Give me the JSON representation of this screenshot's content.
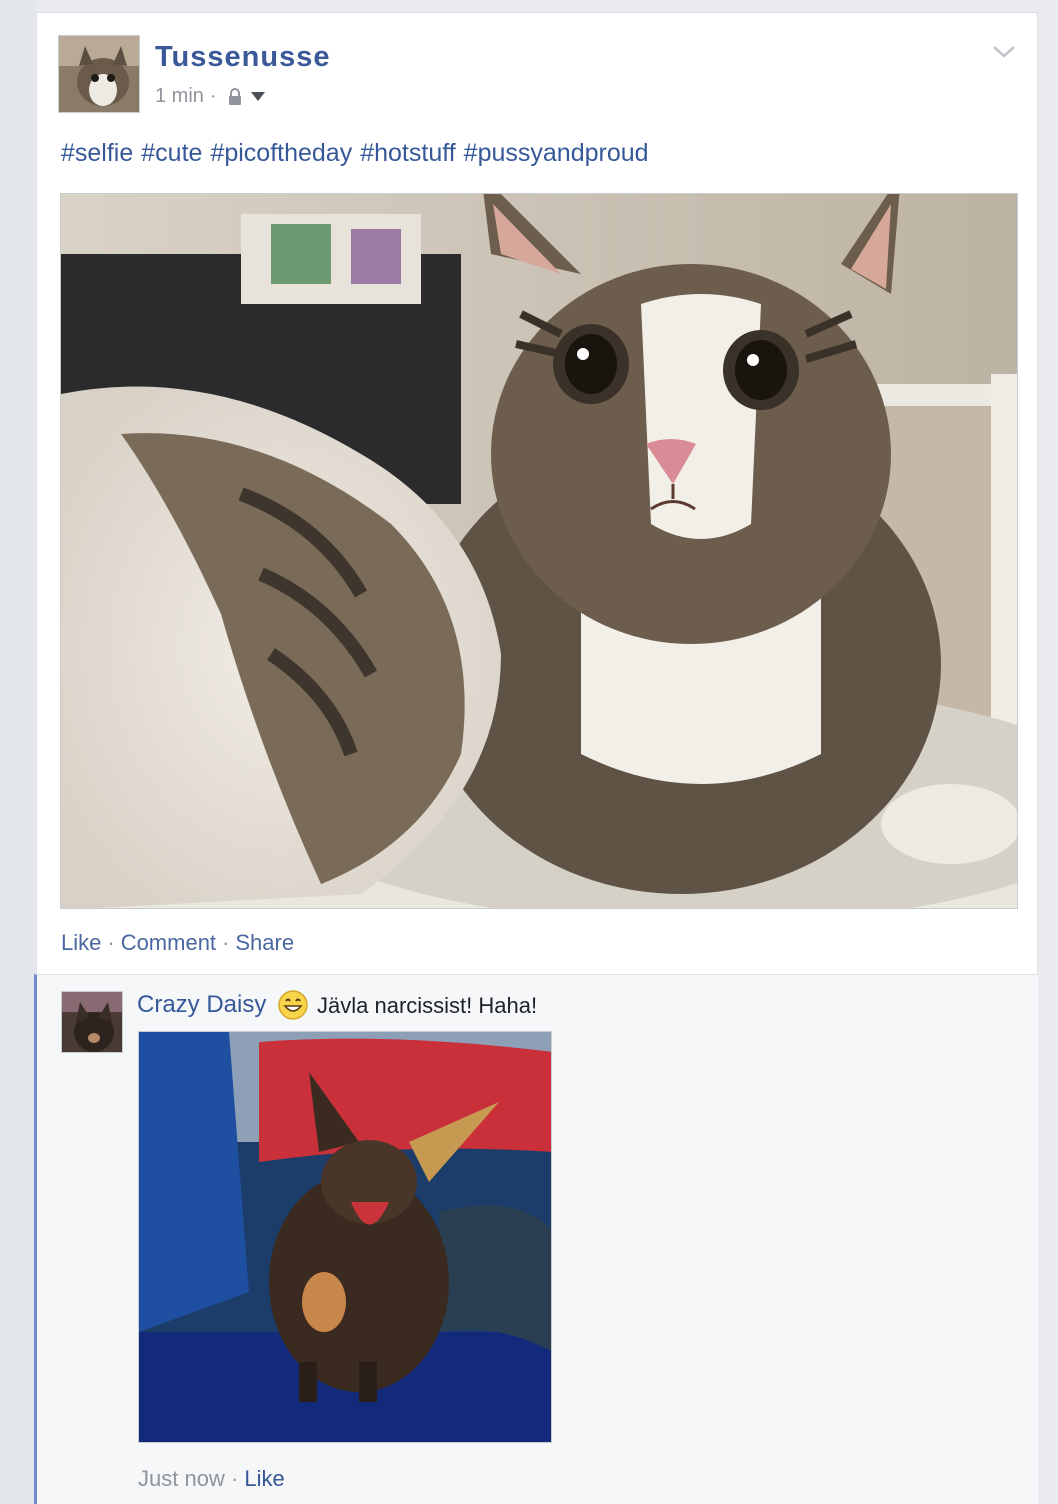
{
  "post": {
    "author": "Tussenusse",
    "time": "1 min",
    "separator": "·",
    "privacy_icon": "lock-icon",
    "audience_icon": "caret-down-icon",
    "options_icon": "chevron-down-icon",
    "caption_tags": [
      "#selfie",
      "#cute",
      "#picoftheday",
      "#hotstuff",
      "#pussyandproud"
    ],
    "actions": {
      "like": "Like",
      "comment": "Comment",
      "share": "Share",
      "sep": "·"
    }
  },
  "comment": {
    "author": "Crazy Daisy",
    "emoji_icon": "grinning-face-icon",
    "text": "Jävla narcissist! Haha!",
    "time": "Just now",
    "sep": "·",
    "like": "Like"
  },
  "colors": {
    "link": "#365899",
    "meta": "#90949c",
    "accent_bar": "#6d8bc7"
  }
}
